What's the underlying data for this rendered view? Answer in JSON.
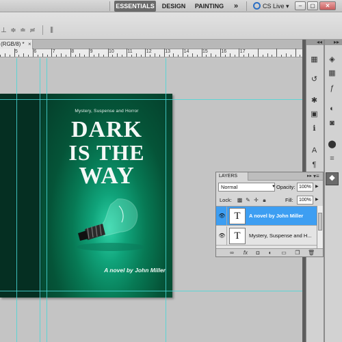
{
  "workspace": {
    "essentials": "ESSENTIALS",
    "design": "DESIGN",
    "painting": "PAINTING",
    "more": "»",
    "cs_live": "CS Live ▾"
  },
  "window": {
    "minimize": "–",
    "maximize": "▢",
    "close": "✕"
  },
  "document": {
    "tab_label": "(RGB/8) *",
    "tab_close": "×"
  },
  "ruler": {
    "numbers": [
      "5",
      "6",
      "7",
      "8",
      "9",
      "10",
      "11",
      "12",
      "13",
      "14",
      "15",
      "16",
      "17"
    ]
  },
  "cover": {
    "subtitle": "Mystery, Suspense and Horror",
    "title_line1": "DARK",
    "title_line2": "IS THE",
    "title_line3": "WAY",
    "byline": "A novel by John Miller"
  },
  "layers_panel": {
    "tab": "LAYERS",
    "collapse": "▸▸",
    "menu": "▾≡",
    "blend_mode": "Normal",
    "opacity_label": "Opacity:",
    "opacity_value": "100%",
    "lock_label": "Lock:",
    "fill_label": "Fill:",
    "fill_value": "100%",
    "layers": [
      {
        "name": "A novel by John Miller",
        "thumb": "T",
        "selected": true
      },
      {
        "name": "Mystery, Suspense and H...",
        "thumb": "T",
        "selected": false
      }
    ]
  },
  "colors": {
    "cover_dark": "#053c29",
    "cover_glow": "#2fd3a8",
    "selection": "#3d9ef2",
    "guide": "#4ad7d7"
  }
}
